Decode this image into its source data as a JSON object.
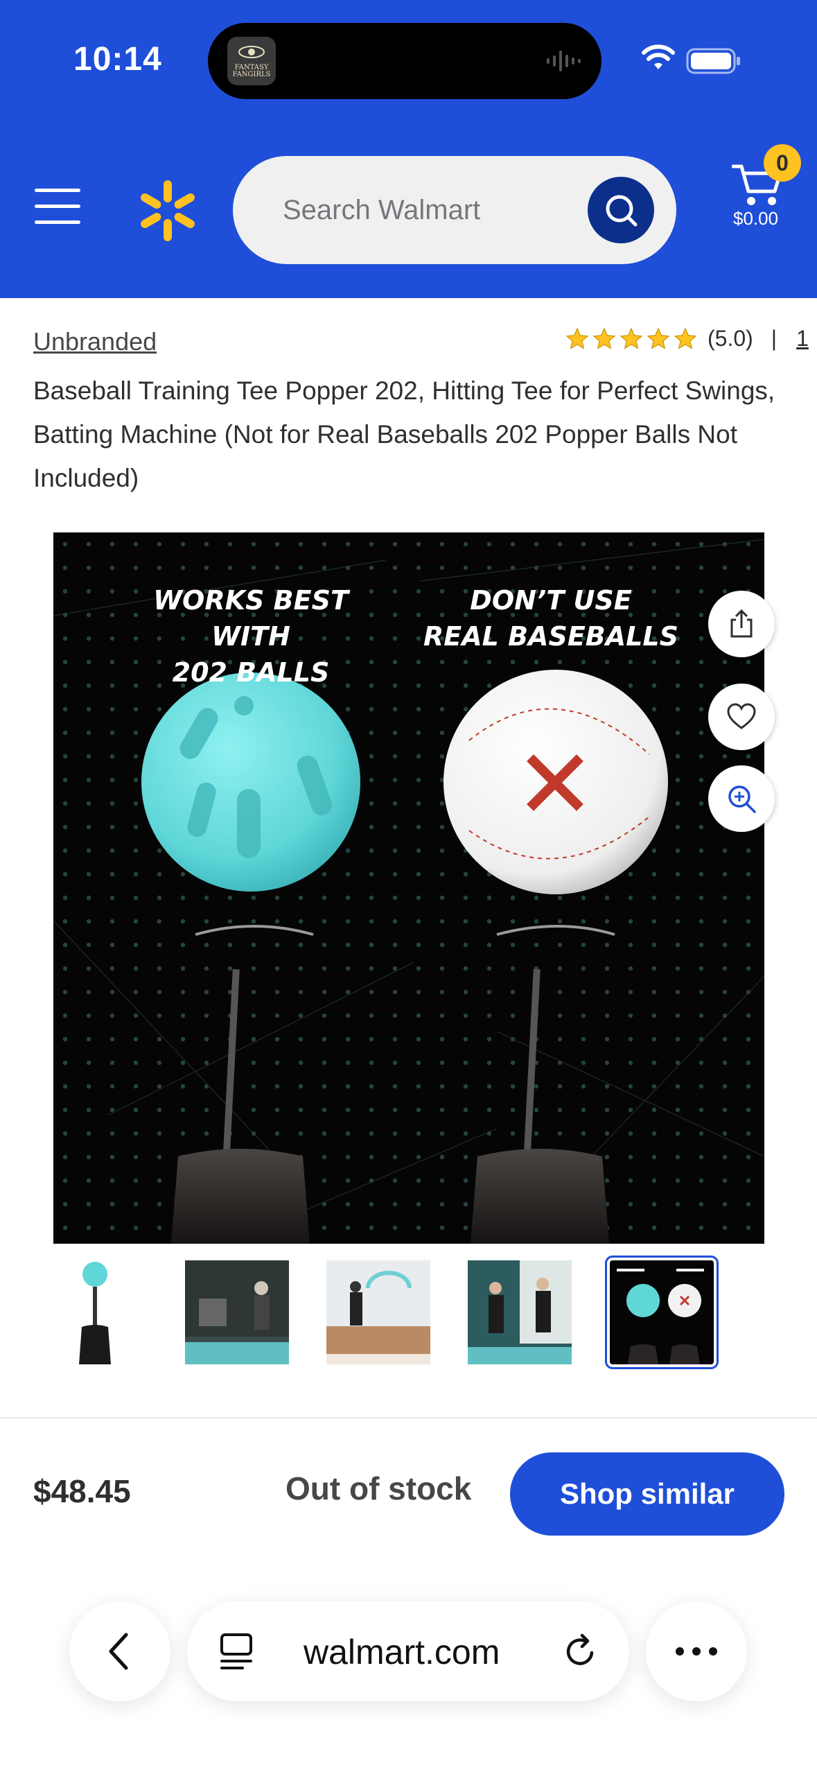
{
  "status_bar": {
    "time": "10:14",
    "live_activity_app": "FANTASY FANGIRLS"
  },
  "header": {
    "search_placeholder": "Search Walmart",
    "cart_count": "0",
    "cart_total": "$0.00",
    "brand_color": "#1f4fd8",
    "spark_color": "#ffc220"
  },
  "product": {
    "brand": "Unbranded",
    "rating_value": "(5.0)",
    "rating_stars": 5,
    "rating_separator": "|",
    "review_count": "1",
    "title": "Baseball Training Tee Popper 202, Hitting Tee for Perfect Swings, Batting Machine (Not for Real Baseballs 202 Popper Balls Not Included)"
  },
  "main_image": {
    "left_caption_line1": "WORKS BEST WITH",
    "left_caption_line2": "202 BALLS",
    "right_caption_line1": "DON’T USE",
    "right_caption_line2": "REAL BASEBALLS"
  },
  "thumbnails": [
    {
      "name": "thumbnail-1",
      "selected": false
    },
    {
      "name": "thumbnail-2",
      "selected": false
    },
    {
      "name": "thumbnail-3",
      "selected": false
    },
    {
      "name": "thumbnail-4",
      "selected": false
    },
    {
      "name": "thumbnail-5",
      "selected": true
    }
  ],
  "buy_bar": {
    "price": "$48.45",
    "stock_status": "Out of stock",
    "cta_label": "Shop similar"
  },
  "browser": {
    "url": "walmart.com"
  }
}
